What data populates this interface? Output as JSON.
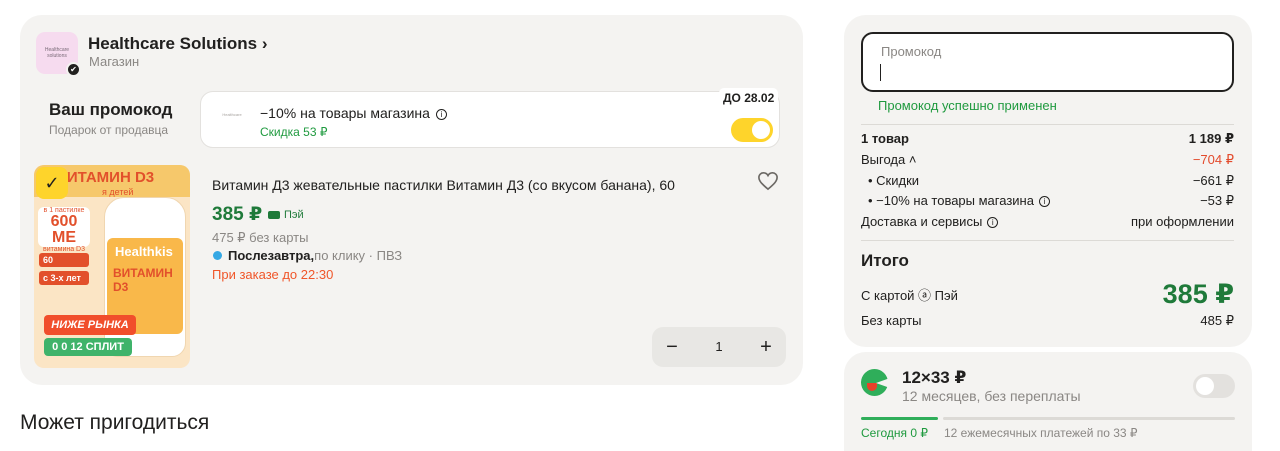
{
  "shop": {
    "logo_text": "Healthcare solutions",
    "name": "Healthcare Solutions ›",
    "type": "Магазин"
  },
  "promo": {
    "title": "Ваш промокод",
    "subtitle": "Подарок от продавца",
    "mini_logo": "Healthcare",
    "description": "−10% на товары магазина",
    "discount": "Скидка 53 ₽",
    "deadline": "ДО 28.02",
    "enabled": true
  },
  "product": {
    "image": {
      "title": "ВИТАМИН D3",
      "subtitle": "я детей",
      "dose_top": "в 1 пастилке",
      "dose_value": "600 МЕ",
      "dose_bottom": "витамина D3",
      "chip1": "60",
      "chip2": "с 3-х лет",
      "brand": "Healthkis",
      "bottle_name": "ВИТАМИН D3",
      "badge_red": "НИЖЕ РЫНКА",
      "badge_green": "0 0 12 СПЛИТ"
    },
    "title": "Витамин Д3 жевательные пастилки Витамин Д3 (со вкусом банана), 60",
    "price_pay": "385 ₽",
    "pay_label": "Пэй",
    "price_nocard": "475 ₽ без карты",
    "delivery_bold": "Послезавтра,",
    "delivery_rest": " по клику · ПВЗ",
    "order_before": "При заказе до 22:30",
    "quantity": "1",
    "minus": "−",
    "plus": "+"
  },
  "may_help": "Может пригодиться",
  "summary": {
    "promo_placeholder": "Промокод",
    "promo_success": "Промокод успешно применен",
    "items_label": "1 товар",
    "items_value": "1 189 ₽",
    "benefit_label": "Выгода ˄",
    "benefit_value": "−704 ₽",
    "discounts_label": "•  Скидки",
    "discounts_value": "−661 ₽",
    "promo_label": "•  −10% на товары магазина",
    "promo_value": "−53 ₽",
    "delivery_label": "Доставка и сервисы",
    "delivery_value": "при оформлении",
    "total_title": "Итого",
    "with_card_label": "С картой ⓐ Пэй",
    "with_card_value": "385 ₽",
    "no_card_label": "Без карты",
    "no_card_value": "485 ₽"
  },
  "split": {
    "amount": "12×33 ₽",
    "subtitle": "12 месяцев, без переплаты",
    "today": "Сегодня 0 ₽",
    "monthly": "12 ежемесячных платежей по 33 ₽",
    "enabled": false
  },
  "colors": {
    "accent_yellow": "#fed42b",
    "price_green": "#1f7a3a",
    "success_green": "#1f9a3f",
    "warning_orange": "#f0562a",
    "card_bg": "#f4f3f1"
  }
}
